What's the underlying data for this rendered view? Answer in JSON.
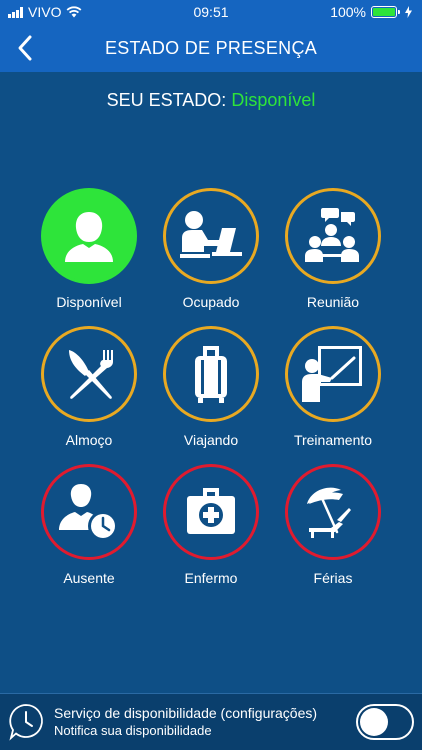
{
  "status_bar": {
    "carrier": "VIVO",
    "time": "09:51",
    "battery": "100%"
  },
  "nav": {
    "title": "ESTADO DE PRESENÇA"
  },
  "current": {
    "label": "SEU ESTADO:",
    "value": "Disponível"
  },
  "colors": {
    "available_green": "#2ee43a",
    "warning_orange": "#e8a922",
    "away_red": "#e01b2f",
    "header_blue": "#1565c0",
    "background": "#0e4f86"
  },
  "options": [
    {
      "label": "Disponível",
      "icon": "person-icon",
      "ring": "green",
      "selected": true
    },
    {
      "label": "Ocupado",
      "icon": "laptop-worker-icon",
      "ring": "orange"
    },
    {
      "label": "Reunião",
      "icon": "meeting-icon",
      "ring": "orange"
    },
    {
      "label": "Almoço",
      "icon": "fork-knife-icon",
      "ring": "orange"
    },
    {
      "label": "Viajando",
      "icon": "suitcase-icon",
      "ring": "orange"
    },
    {
      "label": "Treinamento",
      "icon": "training-icon",
      "ring": "orange"
    },
    {
      "label": "Ausente",
      "icon": "person-clock-icon",
      "ring": "red"
    },
    {
      "label": "Enfermo",
      "icon": "first-aid-kit-icon",
      "ring": "red"
    },
    {
      "label": "Férias",
      "icon": "beach-umbrella-icon",
      "ring": "red"
    }
  ],
  "service": {
    "title": "Serviço de disponibilidade (configurações)",
    "subtitle": "Notifica sua disponibilidade",
    "enabled": false
  }
}
